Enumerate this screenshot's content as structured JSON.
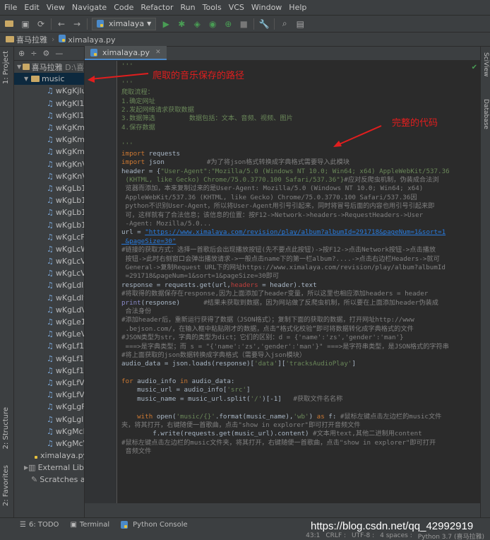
{
  "menubar": [
    "File",
    "Edit",
    "View",
    "Navigate",
    "Code",
    "Refactor",
    "Run",
    "Tools",
    "VCS",
    "Window",
    "Help"
  ],
  "toolbar": {
    "run_config": "ximalaya"
  },
  "breadcrumb": {
    "project": "喜马拉雅",
    "file": "ximalaya.py"
  },
  "left_strip": {
    "project_tab": "1: Project",
    "structure_tab": "2: Structure",
    "favorites_tab": "2: Favorites"
  },
  "right_strip": {
    "sciview_tab": "SciView",
    "database_tab": "Database"
  },
  "project_tree": {
    "root": "喜马拉雅",
    "root_path": "D:\\喜",
    "folder": "music",
    "files": [
      "wKgKjlu",
      "wKgKl1v",
      "wKgKl1v",
      "wKgKml",
      "wKgKml",
      "wKgKmV",
      "wKgKnV",
      "wKgKnV",
      "wKgLb1",
      "wKgLb1",
      "wKgLb1",
      "wKgLb1",
      "wKgLcF",
      "wKgLcW",
      "wKgLcV",
      "wKgLcV",
      "wKgLdlx",
      "wKgLdly",
      "wKgLdV",
      "wKgLe1",
      "wKgLeV",
      "wKgLf1x",
      "wKgLf1x",
      "wKgLf1y",
      "wKgLfV",
      "wKgLfV",
      "wKgLgF",
      "wKgLgl",
      "wKgMcF",
      "wKgMcV"
    ],
    "script": "ximalaya.py",
    "external": "External Librar",
    "scratches": "Scratches and"
  },
  "editor": {
    "tab": "ximalaya.py"
  },
  "code": {
    "l1": "'''",
    "l3": "'''",
    "l4": "爬取流程：",
    "l5": "1.确定网址",
    "l6": "2.发起网络请求获取数据",
    "l7": "3.数据筛选",
    "l7b": "数据包括：文本、音频、视频、图片",
    "l8": "4.保存数据",
    "l10": "'''",
    "l11a": "import",
    "l11b": " requests",
    "l12a": "import",
    "l12b": " json",
    "l12c": "#为了将json格式转换成字典格式需要导入此模块",
    "l13a": "header = {",
    "l13b": "\"User-Agent\":\"Mozilla/5.0 (Windows NT 10.0; Win64; x64) AppleWebKit/537.36",
    "l14a": " (KHTML, like Gecko) Chrome/75.0.3770.100 Safari/537.36\"}",
    "l14b": "#应对反爬虫机制，伪装成合法浏",
    "l15": " 览器而添加，本来复制过来的是User-Agent: Mozilla/5.0 (Windows NT 10.0; Win64; x64)",
    "l16": " AppleWebKit/537.36 (KHTML, like Gecko) Chrome/75.0.3770.100 Safari/537.36因",
    "l17": " python不识别User-Agent，所以将User-Agent用引号引起来，同时将冒号后面的内容也用引号引起来即",
    "l18": " 可，这样就有了合法信息；该信息的位置：按F12->Network->headers->RequestHeaders->User",
    "l19": " -Agent: Mozilla/5.0...",
    "l20a": "url = ",
    "l20b": "\"https://www.ximalaya.com/revision/play/album?albumId=291718&pageNum=1&sort=1",
    "l21": " &pageSize=30\"",
    "l22": "#链接的获取方式：选择一首歌后会出现播放按钮(先不要点此按钮)->按F12->点击Network按钮->点击播放",
    "l23": " 按钮->此时右侧窗口会弹出播放请求->一般点击name下的第一栏album?....->点击右边栏Headers->就可",
    "l24": " General->复制Request URL下的网址https://www.ximalaya.com/revision/play/album?albumId",
    "l25": " =291718&pageNum=1&sort=1&pageSize=30即可",
    "l26a": "response = requests.get(url,",
    "l26b": "headers",
    "l26c": " = header).text",
    "l27": "#将取得的数据保存在response,因为上面添加了header变量，所以这里也相应添加headers = header",
    "l28a": "print",
    "l28b": "(response)",
    "l28c": "      #结果未获取到数据，因为网站做了反爬虫机制，所以要在上面添加header伪装成",
    "l29": " 合法身份",
    "l30": "#添加header后，重新运行获得了数据（JSON格式）；复制下面的获取的数据，打开网址http://www",
    "l31": " .bejson.com/，在输入框中粘贴刚才的数据，点击“格式化校验”即可将数据转化成字典格式的文件",
    "l32": "#JSON类型为str，字典的类型为dict；它们的区别：d = {'name':'zs','gender':'man'}",
    "l33": " ===>是字典类型；而 s = \"{'name':'zs','gender':'man'}\" ===>是字符串类型，是JSON格式的字符串",
    "l34": "#将上面获取的json数据转换成字典格式（需要导入json模块）",
    "l35a": "audio_data = json.loads(response)[",
    "l35b": "'data'",
    "l35c": "][",
    "l35d": "'tracksAudioPlay'",
    "l35e": "]",
    "l37a": "for",
    "l37b": " audio_info ",
    "l37c": "in",
    "l37d": " audio_data:",
    "l38a": "    music_url = audio_info[",
    "l38b": "'src'",
    "l38c": "]",
    "l39a": "    music_name = music_url.split(",
    "l39b": "'/'",
    "l39c": ")[-1]",
    "l39d": "   #获取文件名名称",
    "l41a": "    ",
    "l41b": "with",
    "l41c": " open(",
    "l41d": "'music/{}'",
    "l41e": ".format(music_name),",
    "l41f": "'wb'",
    "l41g": ") ",
    "l41h": "as",
    "l41i": " f: ",
    "l41j": "#鼠标左键点击左边栏的music文件",
    "l42": "夹，将其打开，右键随便一首歌曲，点击\"show in explorer\"即可打开音频文件",
    "l43a": "        f.write(requests.get(music_url).content) ",
    "l43b": "#文本用text,其他二进制用content",
    "l44": "#鼠标左键点击左边栏的music文件夹，将其打开，右键随便一首歌曲，点击\"show in explorer\"即可打开",
    "l45": " 音频文件"
  },
  "annotations": {
    "music_path": "爬取的音乐保存的路径",
    "full_code": "完整的代码"
  },
  "statusbar": {
    "todo": "6: TODO",
    "terminal": "Terminal",
    "console": "Python Console"
  },
  "bottombar": {
    "pos": "43:1",
    "crlf": "CRLF :",
    "enc": "UTF-8 :",
    "spaces": "4 spaces :",
    "python": "Python 3.7 (喜马拉雅)"
  },
  "watermark": "https://blog.csdn.net/qq_42992919",
  "colors": {
    "annotation": "#e11e1e",
    "background": "#2b2b2b"
  }
}
